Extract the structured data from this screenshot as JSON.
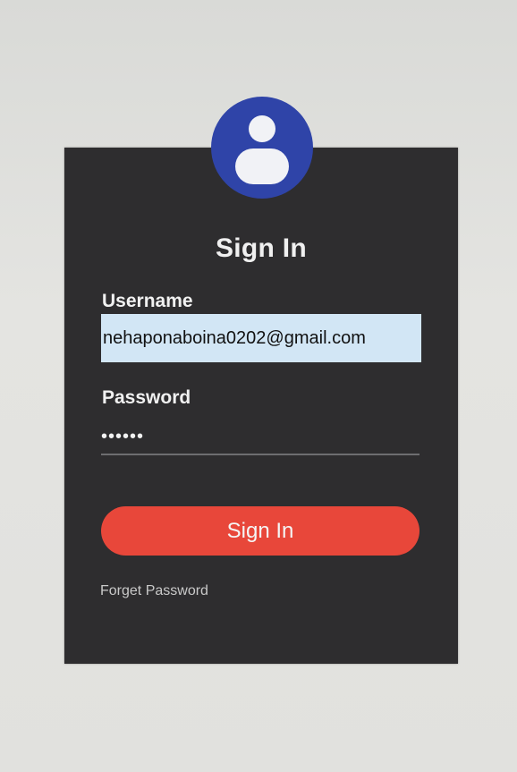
{
  "form": {
    "title": "Sign In",
    "username_label": "Username",
    "username_value": "nehaponaboina0202@gmail.com",
    "password_label": "Password",
    "password_value": "••••••",
    "submit_label": "Sign In",
    "forgot_label": "Forget Password"
  },
  "icons": {
    "avatar": "user-icon"
  },
  "colors": {
    "card_background": "#2e2d2f",
    "avatar_background": "#2f44a8",
    "button_background": "#e8473a",
    "input_background": "#d2e6f5"
  }
}
